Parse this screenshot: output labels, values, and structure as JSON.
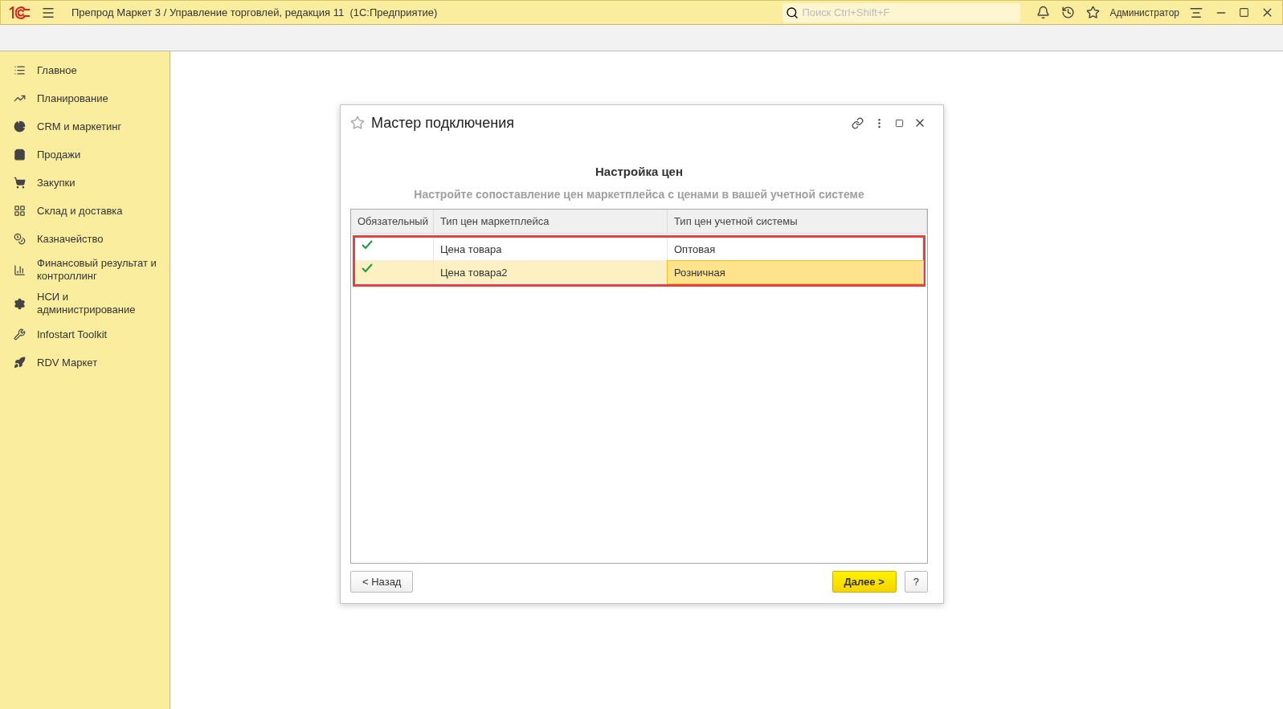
{
  "window": {
    "title": "Препрод Маркет 3 / Управление торговлей, редакция 11  (1С:Предприятие)",
    "search_placeholder": "Поиск Ctrl+Shift+F",
    "user": "Администратор"
  },
  "sidebar": {
    "items": [
      {
        "label": "Главное"
      },
      {
        "label": "Планирование"
      },
      {
        "label": "CRM и маркетинг"
      },
      {
        "label": "Продажи"
      },
      {
        "label": "Закупки"
      },
      {
        "label": "Склад и доставка"
      },
      {
        "label": "Казначейство"
      },
      {
        "label": "Финансовый результат и контроллинг"
      },
      {
        "label": "НСИ и администрирование"
      },
      {
        "label": "Infostart Toolkit"
      },
      {
        "label": "RDV Маркет"
      }
    ]
  },
  "dialog": {
    "title": "Мастер подключения",
    "heading": "Настройка цен",
    "subheading": "Настройте сопоставление цен маркетплейса с ценами в вашей учетной системе",
    "table": {
      "columns": [
        "Обязательный",
        "Тип цен маркетплейса",
        "Тип цен учетной системы"
      ],
      "rows": [
        {
          "checked": true,
          "marketplace_price": "Цена товара",
          "system_price": "Оптовая",
          "selected": false
        },
        {
          "checked": true,
          "marketplace_price": "Цена товара2",
          "system_price": "Розничная",
          "selected": true
        }
      ]
    },
    "buttons": {
      "back": "< Назад",
      "next": "Далее >",
      "help": "?"
    }
  }
}
